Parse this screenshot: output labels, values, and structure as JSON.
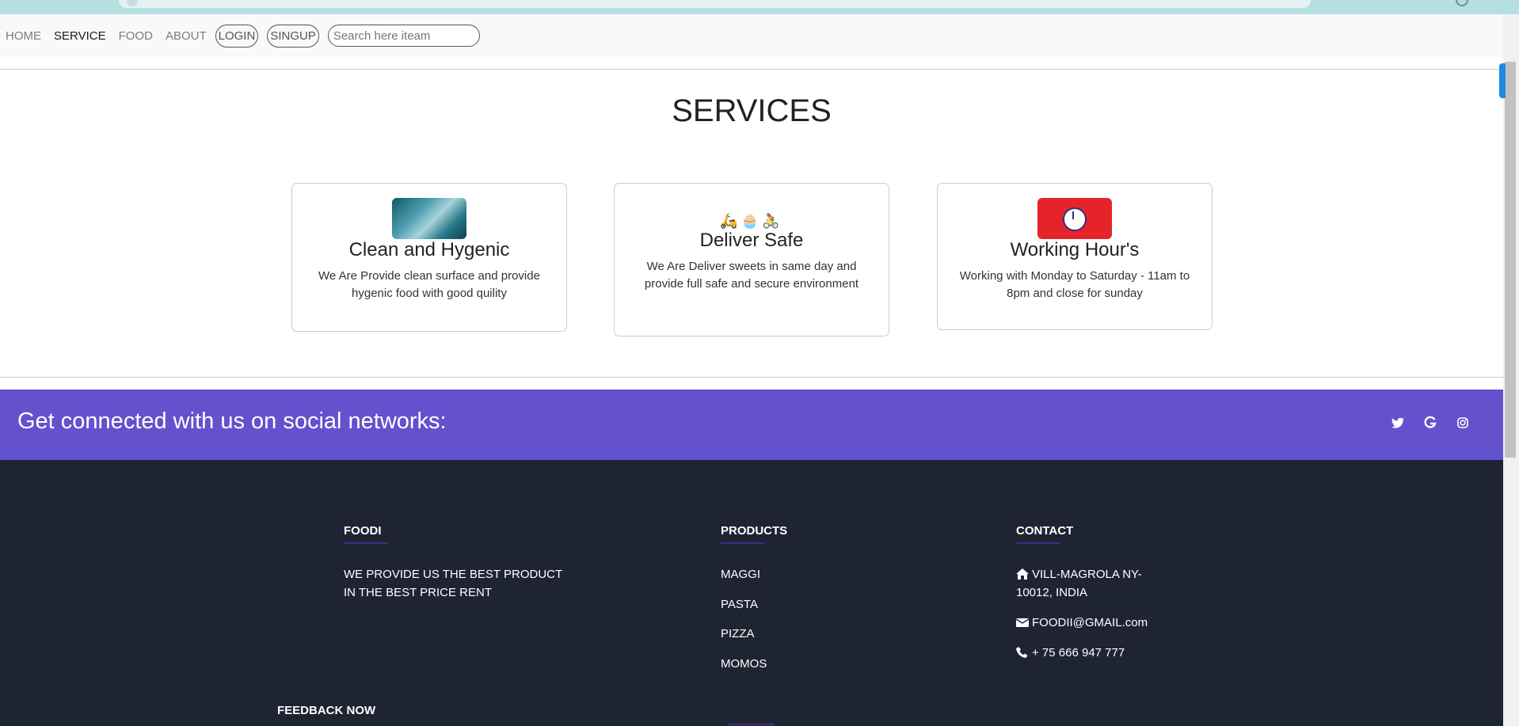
{
  "nav": {
    "links": [
      "HOME",
      "SERVICE",
      "FOOD",
      "ABOUT"
    ],
    "login_label": "LOGIN",
    "signup_label": "SINGUP",
    "search_placeholder": "Search here iteam"
  },
  "services": {
    "title": "SERVICES",
    "cards": [
      {
        "title": "Clean and Hygenic",
        "text": "We Are Provide clean surface and provide hygenic food with good quility",
        "icon": "cleaning-image"
      },
      {
        "title": "Deliver Safe",
        "text": "We Are Deliver sweets in same day and provide full safe and secure environment",
        "icon": "delivery-emojis"
      },
      {
        "title": "Working Hour's",
        "text": "Working with Monday to Saturday - 11am to 8pm and close for sunday",
        "icon": "clock-image"
      }
    ]
  },
  "social": {
    "text": "Get connected with us on social networks:",
    "icons": [
      "twitter-icon",
      "google-icon",
      "instagram-icon"
    ],
    "color": "#6351ce"
  },
  "footer": {
    "background": "#1e2431",
    "foodi": {
      "title": "FOODI",
      "text1": "WE PROVIDE US THE BEST PRODUCT",
      "text2": "IN THE BEST PRICE RENT"
    },
    "products": {
      "title": "PRODUCTS",
      "items": [
        "MAGGI",
        "PASTA",
        "PIZZA",
        "MOMOS"
      ]
    },
    "contact": {
      "title": "CONTACT",
      "address1": "VILL-MAGROLA NY-",
      "address2": "10012, INDIA",
      "email": "FOODII@GMAIL.com",
      "phone": "+ 75 666 947 777"
    },
    "feedback": "FEEDBACK NOW"
  }
}
